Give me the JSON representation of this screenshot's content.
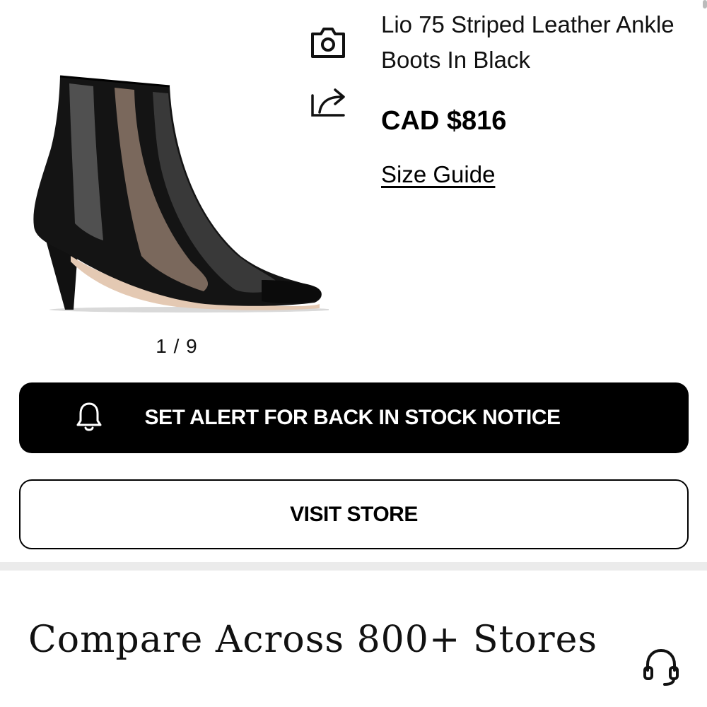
{
  "product": {
    "title": "Lio 75 Striped Leather Ankle Boots In Black",
    "price": "CAD $816",
    "size_guide_label": "Size Guide",
    "image_counter": "1 / 9",
    "image_alt": "Lio 75 Striped Leather Ankle Boots In Black"
  },
  "icons": {
    "camera": "camera-icon",
    "share": "share-icon",
    "bell": "bell-icon",
    "support": "headset-icon"
  },
  "buttons": {
    "alert_label": "SET ALERT FOR BACK IN STOCK NOTICE",
    "visit_store_label": "VISIT STORE"
  },
  "compare": {
    "title": "Compare Across 800+ Stores"
  },
  "colors": {
    "primary": "#000000",
    "background": "#ffffff",
    "divider": "#ebebeb"
  }
}
